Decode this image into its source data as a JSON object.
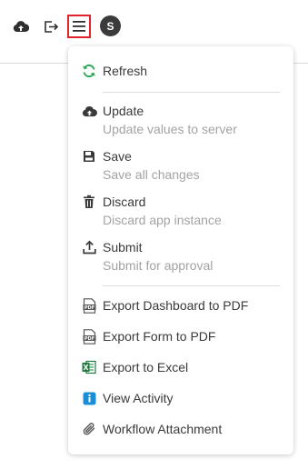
{
  "toolbar": {
    "avatar_initial": "S",
    "icons": [
      "cloud-upload-icon",
      "exit-icon",
      "hamburger-menu-icon"
    ]
  },
  "menu": {
    "refresh": {
      "label": "Refresh",
      "icon": "refresh-icon",
      "color": "#2eaa5a"
    },
    "update": {
      "label": "Update",
      "desc": "Update values to server",
      "icon": "cloud-upload-icon"
    },
    "save": {
      "label": "Save",
      "desc": "Save all changes",
      "icon": "floppy-icon"
    },
    "discard": {
      "label": "Discard",
      "desc": "Discard app instance",
      "icon": "trash-icon"
    },
    "submit": {
      "label": "Submit",
      "desc": "Submit for approval",
      "icon": "upload-icon"
    },
    "export_dashboard_pdf": {
      "label": "Export Dashboard to PDF",
      "icon": "pdf-icon"
    },
    "export_form_pdf": {
      "label": "Export Form to PDF",
      "icon": "pdf-icon"
    },
    "export_excel": {
      "label": "Export to Excel",
      "icon": "excel-icon",
      "color": "#1d7a3e"
    },
    "view_activity": {
      "label": "View Activity",
      "icon": "info-icon",
      "color": "#1a8fd6"
    },
    "workflow_attachment": {
      "label": "Workflow Attachment",
      "icon": "paperclip-icon"
    }
  }
}
